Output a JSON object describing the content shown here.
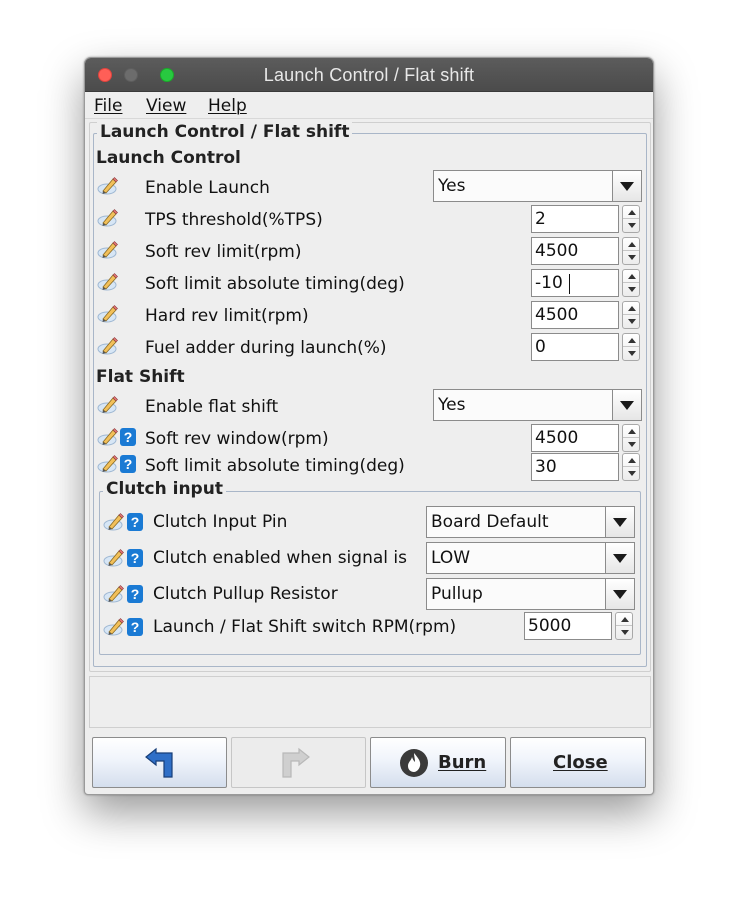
{
  "window": {
    "title": "Launch Control / Flat shift"
  },
  "menu": {
    "file": "File",
    "view": "View",
    "help": "Help"
  },
  "panel": {
    "legend": "Launch Control / Flat shift",
    "launch_control": {
      "title": "Launch Control",
      "enable_launch": {
        "label": "Enable Launch",
        "value": "Yes"
      },
      "tps_threshold": {
        "label": "TPS threshold(%TPS)",
        "value": "2"
      },
      "soft_rev_limit": {
        "label": "Soft rev limit(rpm)",
        "value": "4500"
      },
      "soft_limit_timing": {
        "label": "Soft limit absolute timing(deg)",
        "value": "-10"
      },
      "hard_rev_limit": {
        "label": "Hard rev limit(rpm)",
        "value": "4500"
      },
      "fuel_adder": {
        "label": "Fuel adder during launch(%)",
        "value": "0"
      }
    },
    "flat_shift": {
      "title": "Flat Shift",
      "enable_flat_shift": {
        "label": "Enable flat shift",
        "value": "Yes"
      },
      "soft_rev_window": {
        "label": "Soft rev window(rpm)",
        "value": "4500"
      },
      "soft_limit_timing": {
        "label": "Soft limit absolute timing(deg)",
        "value": "30"
      }
    },
    "clutch_input": {
      "legend": "Clutch input",
      "input_pin": {
        "label": "Clutch Input Pin",
        "value": "Board Default"
      },
      "enabled_when": {
        "label": "Clutch enabled when signal is",
        "value": "LOW"
      },
      "pullup": {
        "label": "Clutch Pullup Resistor",
        "value": "Pullup"
      },
      "switch_rpm": {
        "label": "Launch / Flat Shift switch RPM(rpm)",
        "value": "5000"
      }
    }
  },
  "buttons": {
    "burn": "Burn",
    "close": "Close"
  },
  "icons": {
    "undo": "undo-arrow-icon",
    "redo": "redo-arrow-icon",
    "burn": "flame-icon",
    "edit": "pencil-icon",
    "help": "help-icon"
  }
}
